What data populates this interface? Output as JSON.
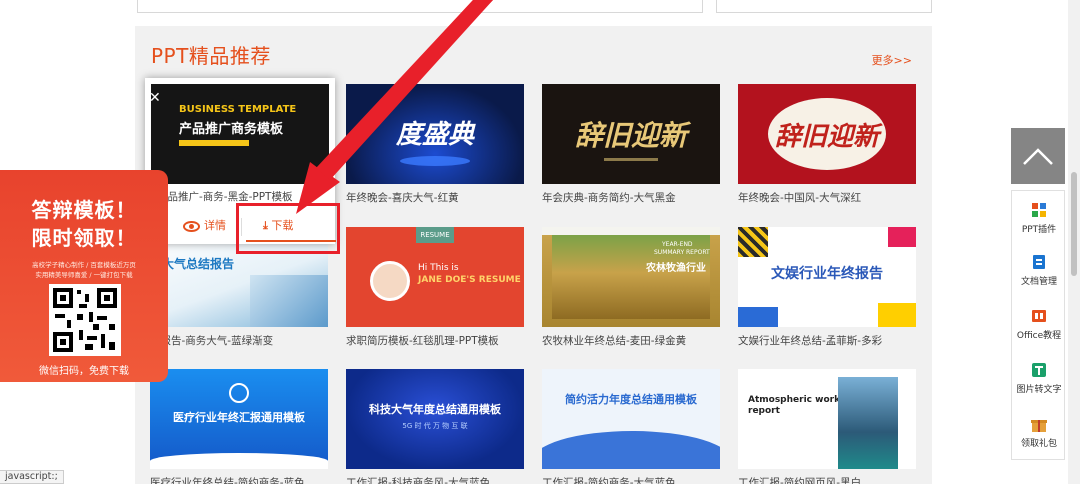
{
  "section": {
    "title": "PPT精品推荐",
    "more": "更多>>"
  },
  "popup": {
    "thumb_line1": "BUSINESS TEMPLATE",
    "thumb_line2": "产品推广商务模板",
    "caption": "产品推广-商务-黑金-PPT模板",
    "detail_label": "详情",
    "download_label": "下载"
  },
  "cards": [
    {
      "caption": "年终晚会-喜庆大气-红黄",
      "thumb_text": "度盛典",
      "bg": "#0a1a4a"
    },
    {
      "caption": "年会庆典-商务简约-大气黑金",
      "thumb_text": "辞旧迎新",
      "bg": "#1a1410"
    },
    {
      "caption": "年终晚会-中国风-大气深红",
      "thumb_text": "辞旧迎新",
      "bg": "#b3121e"
    },
    {
      "caption": "结报告-商务大气-蓝绿渐变",
      "thumb_text": "务大气总结报告",
      "bg": "#e8f2f8"
    },
    {
      "caption": "求职简历模板-红毯肌理-PPT模板",
      "thumb_text_1": "RESUME",
      "thumb_text_2": "Hi This is",
      "thumb_text_3": "JANE DOE'S RESUME",
      "bg": "#e3452f"
    },
    {
      "caption": "农牧林业年终总结-麦田-绿金黄",
      "thumb_text_1": "YEAR-END",
      "thumb_text_2": "SUMMARY REPORT",
      "thumb_text_3": "农林牧渔行业",
      "bg": "#c8a24a"
    },
    {
      "caption": "文娱行业年终总结-孟菲斯-多彩",
      "thumb_text": "文娱行业年终报告",
      "bg": "#ffffff"
    },
    {
      "caption": "医疗行业年终总结-简约商务-蓝色",
      "thumb_text": "医疗行业年终汇报通用模板",
      "bg": "#1a6ad6"
    },
    {
      "caption": "工作汇报-科技商务风-大气蓝色",
      "thumb_text_1": "科技大气年度总结通用模板",
      "thumb_text_2": "5G 时 代 万 物 互 联",
      "bg": "#0d2a8a"
    },
    {
      "caption": "工作汇报-简约商务-大气蓝色",
      "thumb_text": "简约活力年度总结通用模板",
      "bg": "#eef4fb"
    },
    {
      "caption": "工作汇报-简约网页风-黑白",
      "thumb_text_1": "Atmospheric work",
      "thumb_text_2": "report",
      "bg": "#ffffff"
    }
  ],
  "promo": {
    "line1": "答辩模板！",
    "line2": "限时领取！",
    "sub1": "高校学子精心制作 / 百套模板近万页",
    "sub2": "实用精美导师喜爱 / 一键打包下载",
    "footer": "微信扫码，免费下载"
  },
  "side": {
    "items": [
      {
        "label": "PPT插件",
        "icon": "ppt-plugin-icon"
      },
      {
        "label": "文档管理",
        "icon": "document-manage-icon"
      },
      {
        "label": "Office教程",
        "icon": "office-tutorial-icon"
      },
      {
        "label": "图片转文字",
        "icon": "image-to-text-icon"
      },
      {
        "label": "领取礼包",
        "icon": "gift-icon"
      }
    ]
  },
  "status": {
    "text": "javascript:;"
  },
  "colors": {
    "accent": "#e5501d",
    "highlight": "#e8202a"
  }
}
